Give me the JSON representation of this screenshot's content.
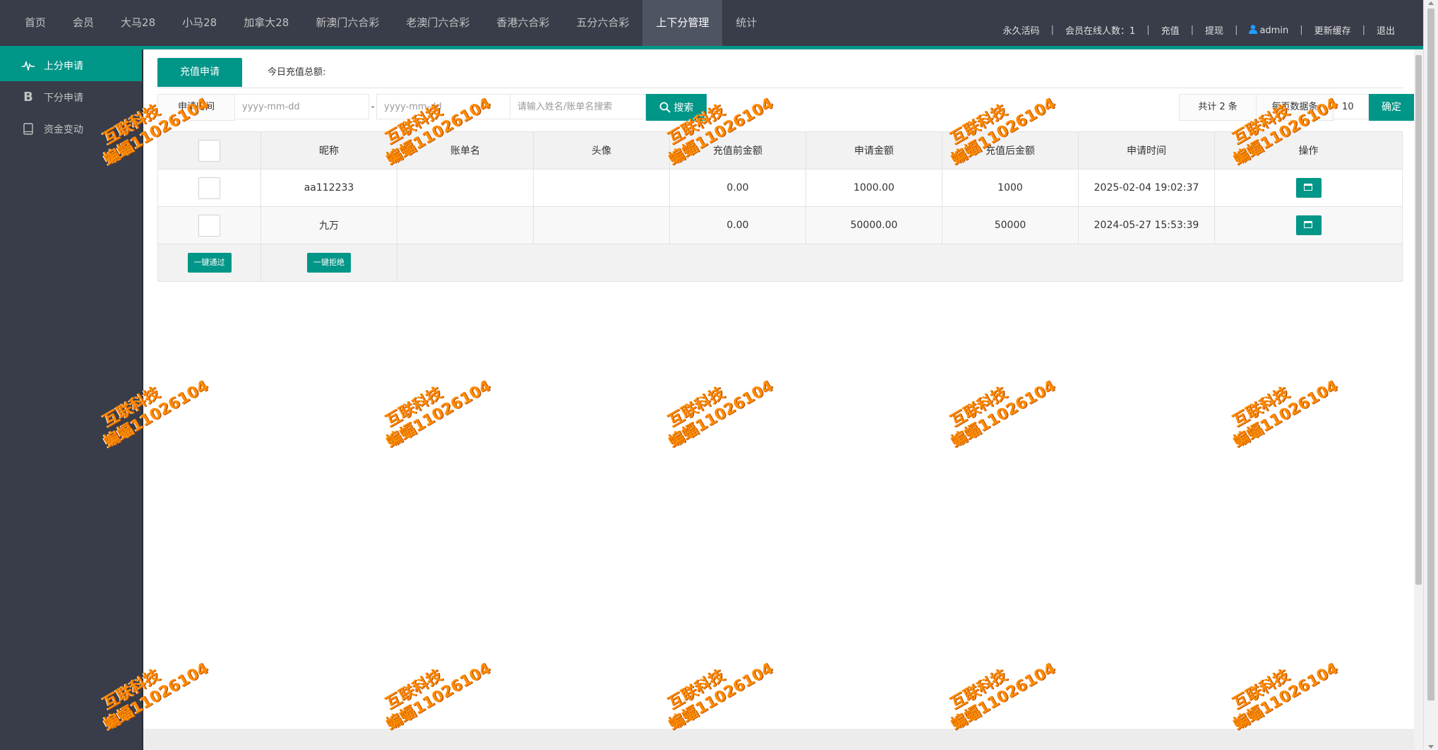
{
  "nav": {
    "items": [
      "首页",
      "会员",
      "大马28",
      "小马28",
      "加拿大28",
      "新澳门六合彩",
      "老澳门六合彩",
      "香港六合彩",
      "五分六合彩",
      "上下分管理",
      "统计"
    ],
    "active_index": 9
  },
  "right_nav": {
    "activation": "永久活码",
    "online": "会员在线人数：1",
    "recharge": "充值",
    "withdraw": "提现",
    "user": "admin",
    "refresh_cache": "更新缓存",
    "logout": "退出",
    "separator": "|"
  },
  "sidebar": {
    "items": [
      {
        "label": "上分申请",
        "icon": "pulse-icon",
        "active": true
      },
      {
        "label": "下分申请",
        "icon": "b-icon",
        "glyph": "B"
      },
      {
        "label": "资金变动",
        "icon": "tablet-icon"
      }
    ]
  },
  "tabs": {
    "active": "充值申请",
    "summary": "今日充值总额:"
  },
  "filter": {
    "time_label": "申请时间",
    "start_placeholder": "yyyy-mm-dd",
    "dash": "-",
    "end_placeholder": "yyyy-mm-dd",
    "keyword_placeholder": "请输入姓名/账单名搜索",
    "search_label": "搜索"
  },
  "pager": {
    "total": "共计 2 条",
    "per_page_label": "每页数据条",
    "per_page_value": "10",
    "confirm": "确定"
  },
  "table": {
    "columns": [
      "昵称",
      "账单名",
      "头像",
      "充值前金额",
      "申请金额",
      "充值后金额",
      "申请时间",
      "操作"
    ],
    "rows": [
      {
        "nickname": "aa112233",
        "bill_name": "",
        "avatar": "",
        "before": "0.00",
        "amount": "1000.00",
        "after": "1000",
        "time": "2025-02-04 19:02:37"
      },
      {
        "nickname": "九万",
        "bill_name": "",
        "avatar": "",
        "before": "0.00",
        "amount": "50000.00",
        "after": "50000",
        "time": "2024-05-27 15:53:39"
      }
    ],
    "approve_all": "一键通过",
    "reject_all": "一键拒绝"
  },
  "watermark": {
    "line1": "互联科技",
    "line2": "蝙蝠11026104"
  },
  "colors": {
    "accent": "#009688",
    "topbar": "#393d49",
    "watermark": "#ff8c00"
  }
}
